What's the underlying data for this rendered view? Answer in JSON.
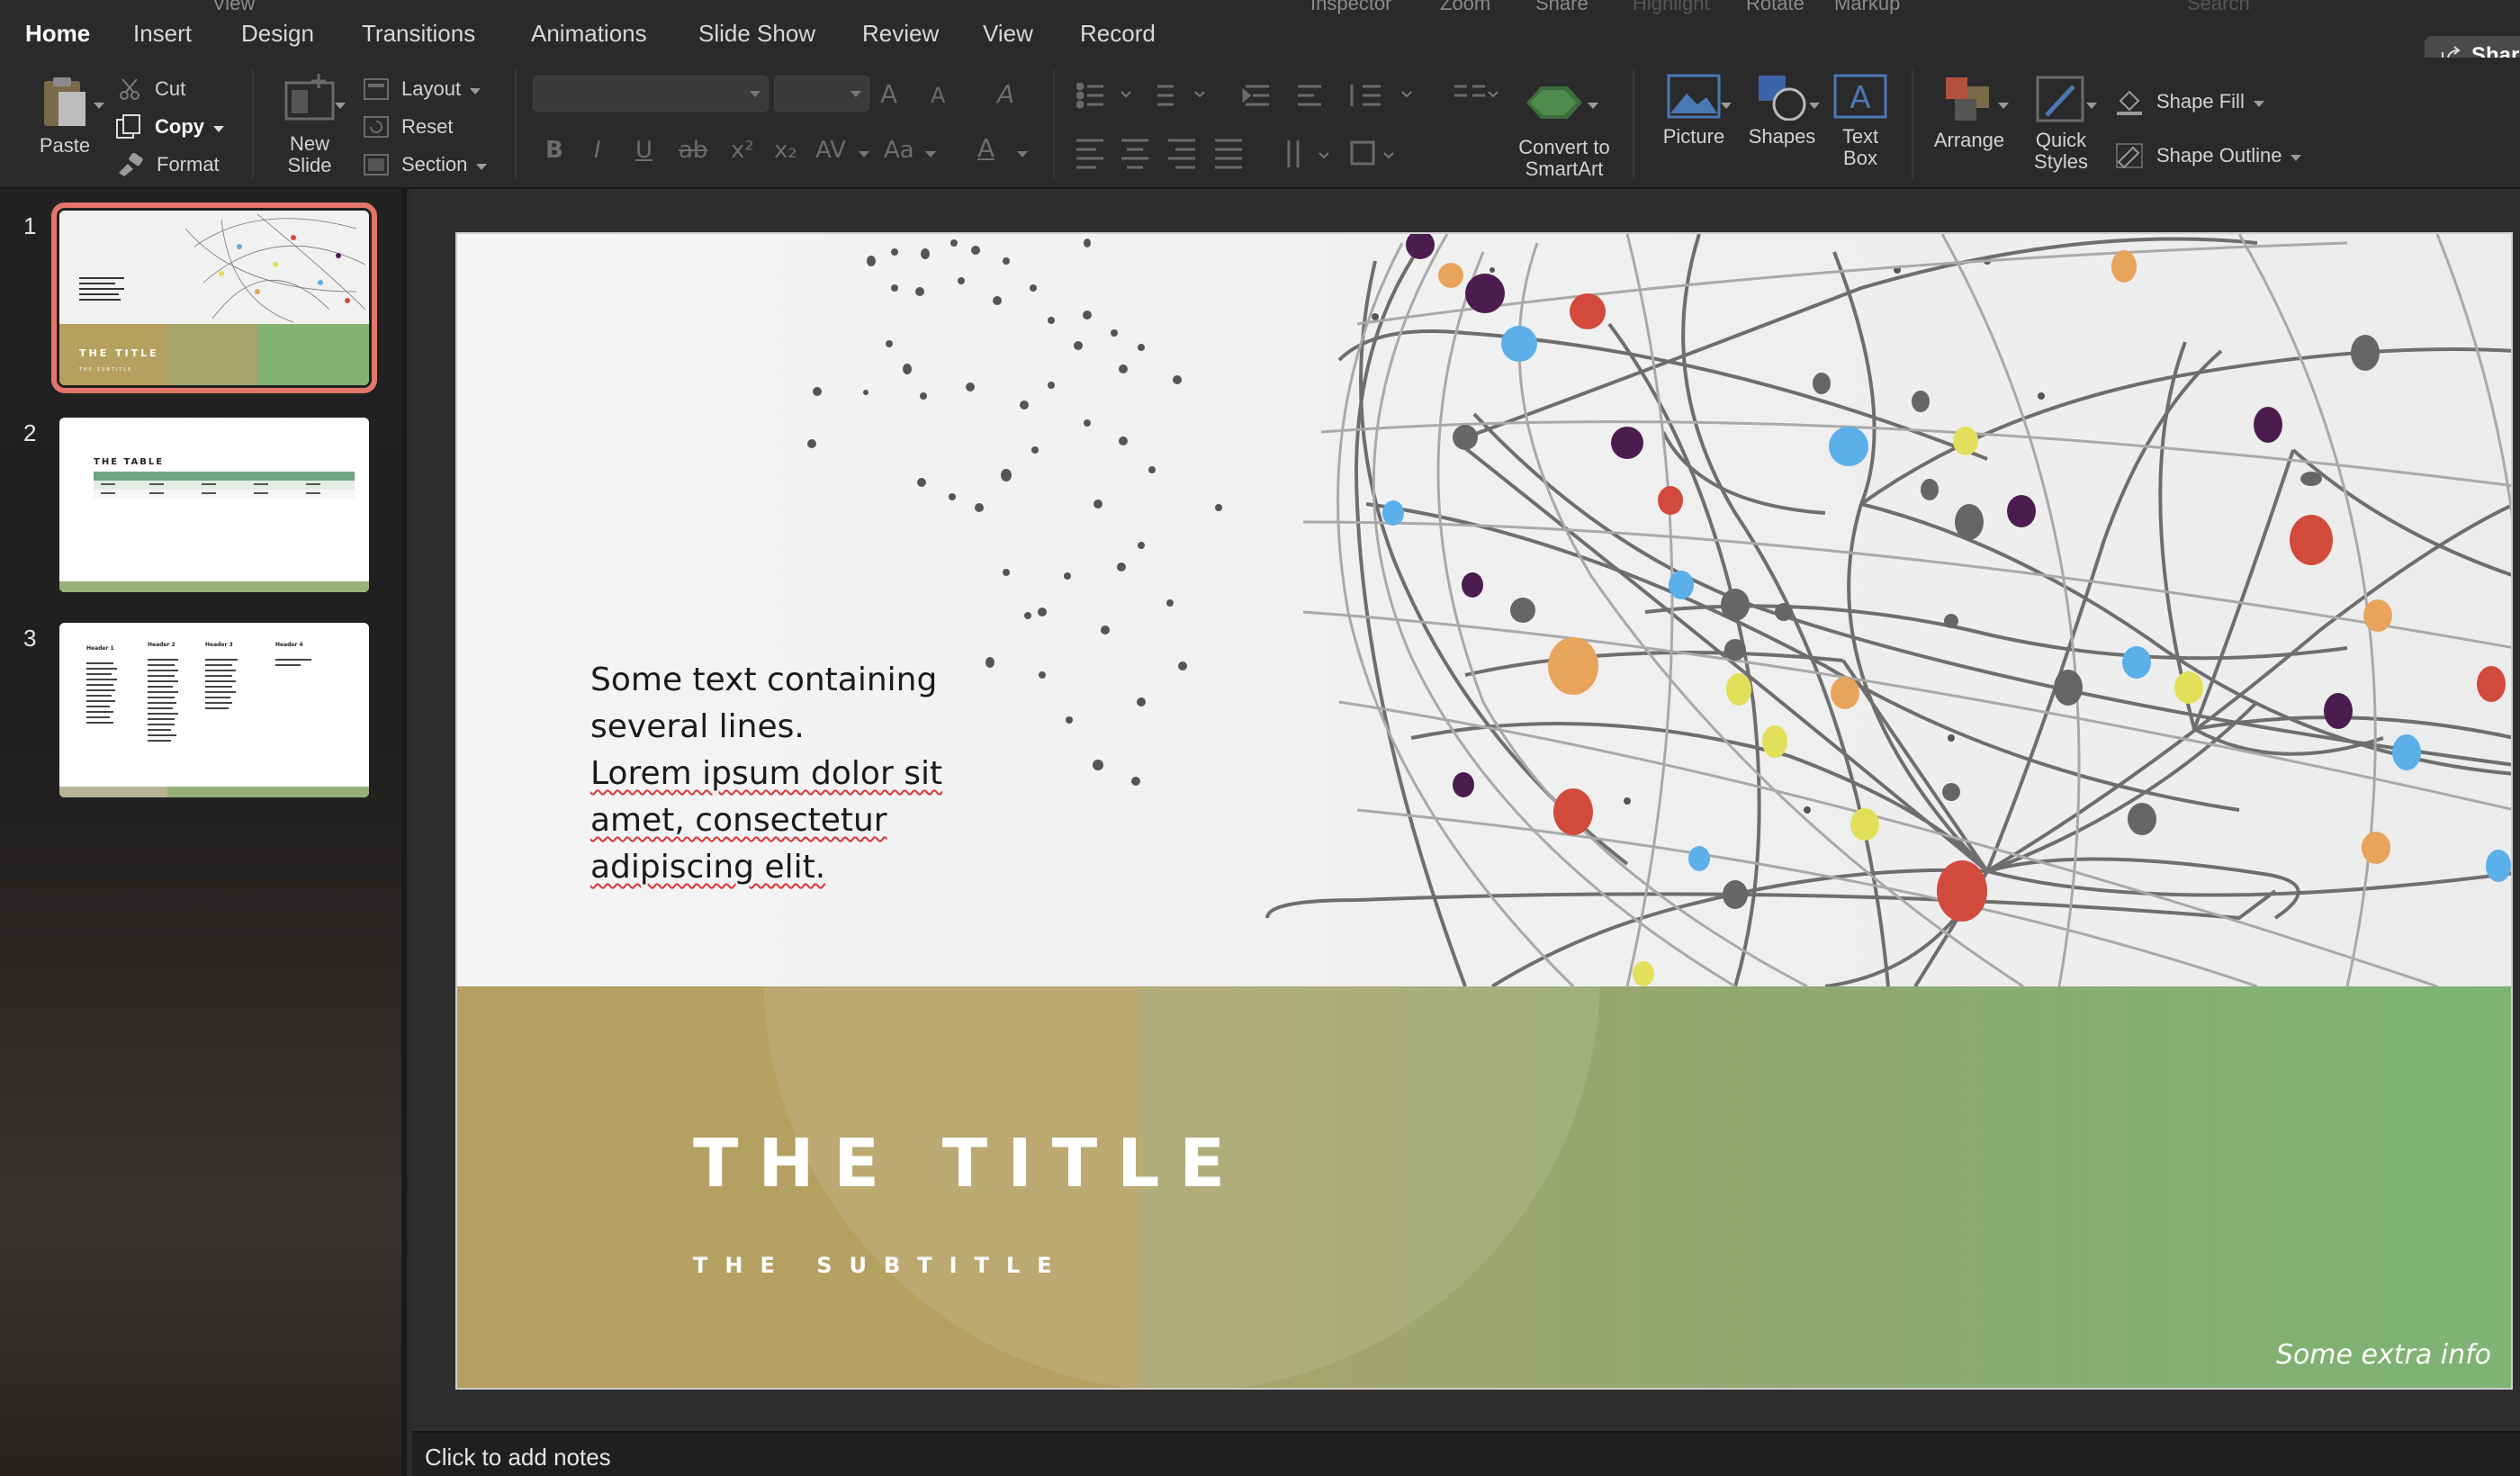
{
  "topbar": {
    "items": [
      "View",
      "Inspector",
      "Zoom",
      "Share",
      "Highlight",
      "Rotate",
      "Markup",
      "Search"
    ]
  },
  "tabs": [
    "Home",
    "Insert",
    "Design",
    "Transitions",
    "Animations",
    "Slide Show",
    "Review",
    "View",
    "Record"
  ],
  "active_tab": "Home",
  "share_label": "Shar",
  "ribbon": {
    "paste": "Paste",
    "cut": "Cut",
    "copy": "Copy",
    "format": "Format",
    "new_slide_line1": "New",
    "new_slide_line2": "Slide",
    "layout": "Layout",
    "reset": "Reset",
    "section": "Section",
    "convert_line1": "Convert to",
    "convert_line2": "SmartArt",
    "picture": "Picture",
    "shapes": "Shapes",
    "text_box_line1": "Text",
    "text_box_line2": "Box",
    "arrange": "Arrange",
    "quick_styles_line1": "Quick",
    "quick_styles_line2": "Styles",
    "shape_fill": "Shape Fill",
    "shape_outline": "Shape Outline"
  },
  "thumbnails": [
    {
      "number": "1",
      "title": "THE TITLE",
      "subtitle": "THE SUBTITLE",
      "selected": true
    },
    {
      "number": "2",
      "title": "THE TABLE",
      "selected": false
    },
    {
      "number": "3",
      "headers": [
        "Header 1",
        "Header 2",
        "Header 3",
        "Header 4"
      ],
      "selected": false
    }
  ],
  "slide": {
    "body_lines": [
      "Some text containing",
      "several lines.",
      "Lorem ipsum dolor sit",
      "amet, consectetur",
      "adipiscing elit."
    ],
    "title": "THE TITLE",
    "subtitle": "THE SUBTITLE",
    "extra": "Some extra info"
  },
  "notes_placeholder": "Click to add notes",
  "colors": {
    "accent_selected": "#e4756a",
    "band_gold": "#b5a060",
    "band_green": "#7db474",
    "ribbon_bg": "#2a2a2a"
  }
}
